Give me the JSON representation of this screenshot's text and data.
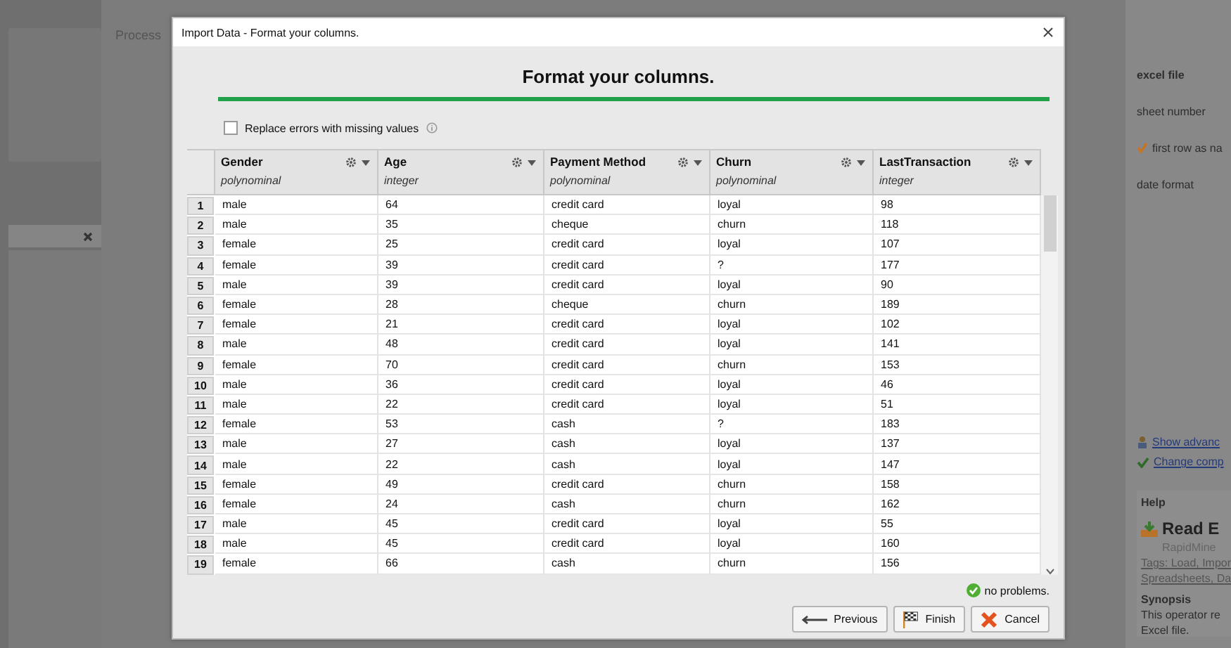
{
  "background": {
    "process_tab": "Process",
    "parameters": [
      {
        "label": "excel file",
        "kind": "label"
      },
      {
        "label": "sheet number",
        "kind": "label"
      },
      {
        "label": "first row as na",
        "kind": "checkbox",
        "checked": true
      },
      {
        "label": "date format",
        "kind": "label"
      }
    ],
    "links": [
      {
        "label": "Show advanc",
        "kind": "advanced"
      },
      {
        "label": "Change comp",
        "kind": "compat"
      }
    ],
    "help": {
      "title": "Help",
      "operator": "Read E",
      "vendor": "RapidMine",
      "tags": [
        "Tags: Load, Impor",
        "Spreadsheets, Da"
      ],
      "synopsis_heading": "Synopsis",
      "synopsis": [
        "This operator re",
        "Excel file."
      ]
    }
  },
  "dialog": {
    "title": "Import Data - Format your columns.",
    "heading": "Format your columns.",
    "replace_errors": {
      "label": "Replace errors with missing values",
      "checked": false
    },
    "columns": [
      {
        "name": "Gender",
        "type": "polynominal"
      },
      {
        "name": "Age",
        "type": "integer"
      },
      {
        "name": "Payment Method",
        "type": "polynominal"
      },
      {
        "name": "Churn",
        "type": "polynominal"
      },
      {
        "name": "LastTransaction",
        "type": "integer"
      }
    ],
    "rows": [
      {
        "number": "1",
        "cells": [
          "male",
          "64",
          "credit card",
          "loyal",
          "98"
        ]
      },
      {
        "number": "2",
        "cells": [
          "male",
          "35",
          "cheque",
          "churn",
          "118"
        ]
      },
      {
        "number": "3",
        "cells": [
          "female",
          "25",
          "credit card",
          "loyal",
          "107"
        ]
      },
      {
        "number": "4",
        "cells": [
          "female",
          "39",
          "credit card",
          "?",
          "177"
        ]
      },
      {
        "number": "5",
        "cells": [
          "male",
          "39",
          "credit card",
          "loyal",
          "90"
        ]
      },
      {
        "number": "6",
        "cells": [
          "female",
          "28",
          "cheque",
          "churn",
          "189"
        ]
      },
      {
        "number": "7",
        "cells": [
          "female",
          "21",
          "credit card",
          "loyal",
          "102"
        ]
      },
      {
        "number": "8",
        "cells": [
          "male",
          "48",
          "credit card",
          "loyal",
          "141"
        ]
      },
      {
        "number": "9",
        "cells": [
          "female",
          "70",
          "credit card",
          "churn",
          "153"
        ]
      },
      {
        "number": "10",
        "cells": [
          "male",
          "36",
          "credit card",
          "loyal",
          "46"
        ]
      },
      {
        "number": "11",
        "cells": [
          "male",
          "22",
          "credit card",
          "loyal",
          "51"
        ]
      },
      {
        "number": "12",
        "cells": [
          "female",
          "53",
          "cash",
          "?",
          "183"
        ]
      },
      {
        "number": "13",
        "cells": [
          "male",
          "27",
          "cash",
          "loyal",
          "137"
        ]
      },
      {
        "number": "14",
        "cells": [
          "male",
          "22",
          "cash",
          "loyal",
          "147"
        ]
      },
      {
        "number": "15",
        "cells": [
          "female",
          "49",
          "credit card",
          "churn",
          "158"
        ]
      },
      {
        "number": "16",
        "cells": [
          "female",
          "24",
          "cash",
          "churn",
          "162"
        ]
      },
      {
        "number": "17",
        "cells": [
          "male",
          "45",
          "credit card",
          "loyal",
          "55"
        ]
      },
      {
        "number": "18",
        "cells": [
          "male",
          "45",
          "credit card",
          "loyal",
          "160"
        ]
      },
      {
        "number": "19",
        "cells": [
          "female",
          "66",
          "cash",
          "churn",
          "156"
        ]
      }
    ],
    "status": "no problems.",
    "buttons": [
      {
        "label": "Previous",
        "kind": "previous"
      },
      {
        "label": "Finish",
        "kind": "finish"
      },
      {
        "label": "Cancel",
        "kind": "cancel"
      }
    ]
  }
}
